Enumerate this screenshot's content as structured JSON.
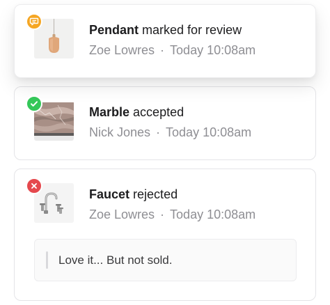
{
  "notifications": [
    {
      "item": "Pendant",
      "action": "marked for review",
      "author": "Zoe Lowres",
      "separator": "·",
      "time": "Today 10:08am",
      "status": "review",
      "status_icon": "chat-bubble-icon",
      "status_color": "#f5a623",
      "thumbnail": "pendant-lamp-image"
    },
    {
      "item": "Marble",
      "action": "accepted",
      "author": "Nick Jones",
      "separator": "·",
      "time": "Today 10:08am",
      "status": "accepted",
      "status_icon": "check-icon",
      "status_color": "#34c759",
      "thumbnail": "marble-slab-image"
    },
    {
      "item": "Faucet",
      "action": "rejected",
      "author": "Zoe Lowres",
      "separator": "·",
      "time": "Today 10:08am",
      "status": "rejected",
      "status_icon": "x-icon",
      "status_color": "#e5484d",
      "thumbnail": "faucet-image",
      "comment": "Love it... But not sold."
    }
  ]
}
